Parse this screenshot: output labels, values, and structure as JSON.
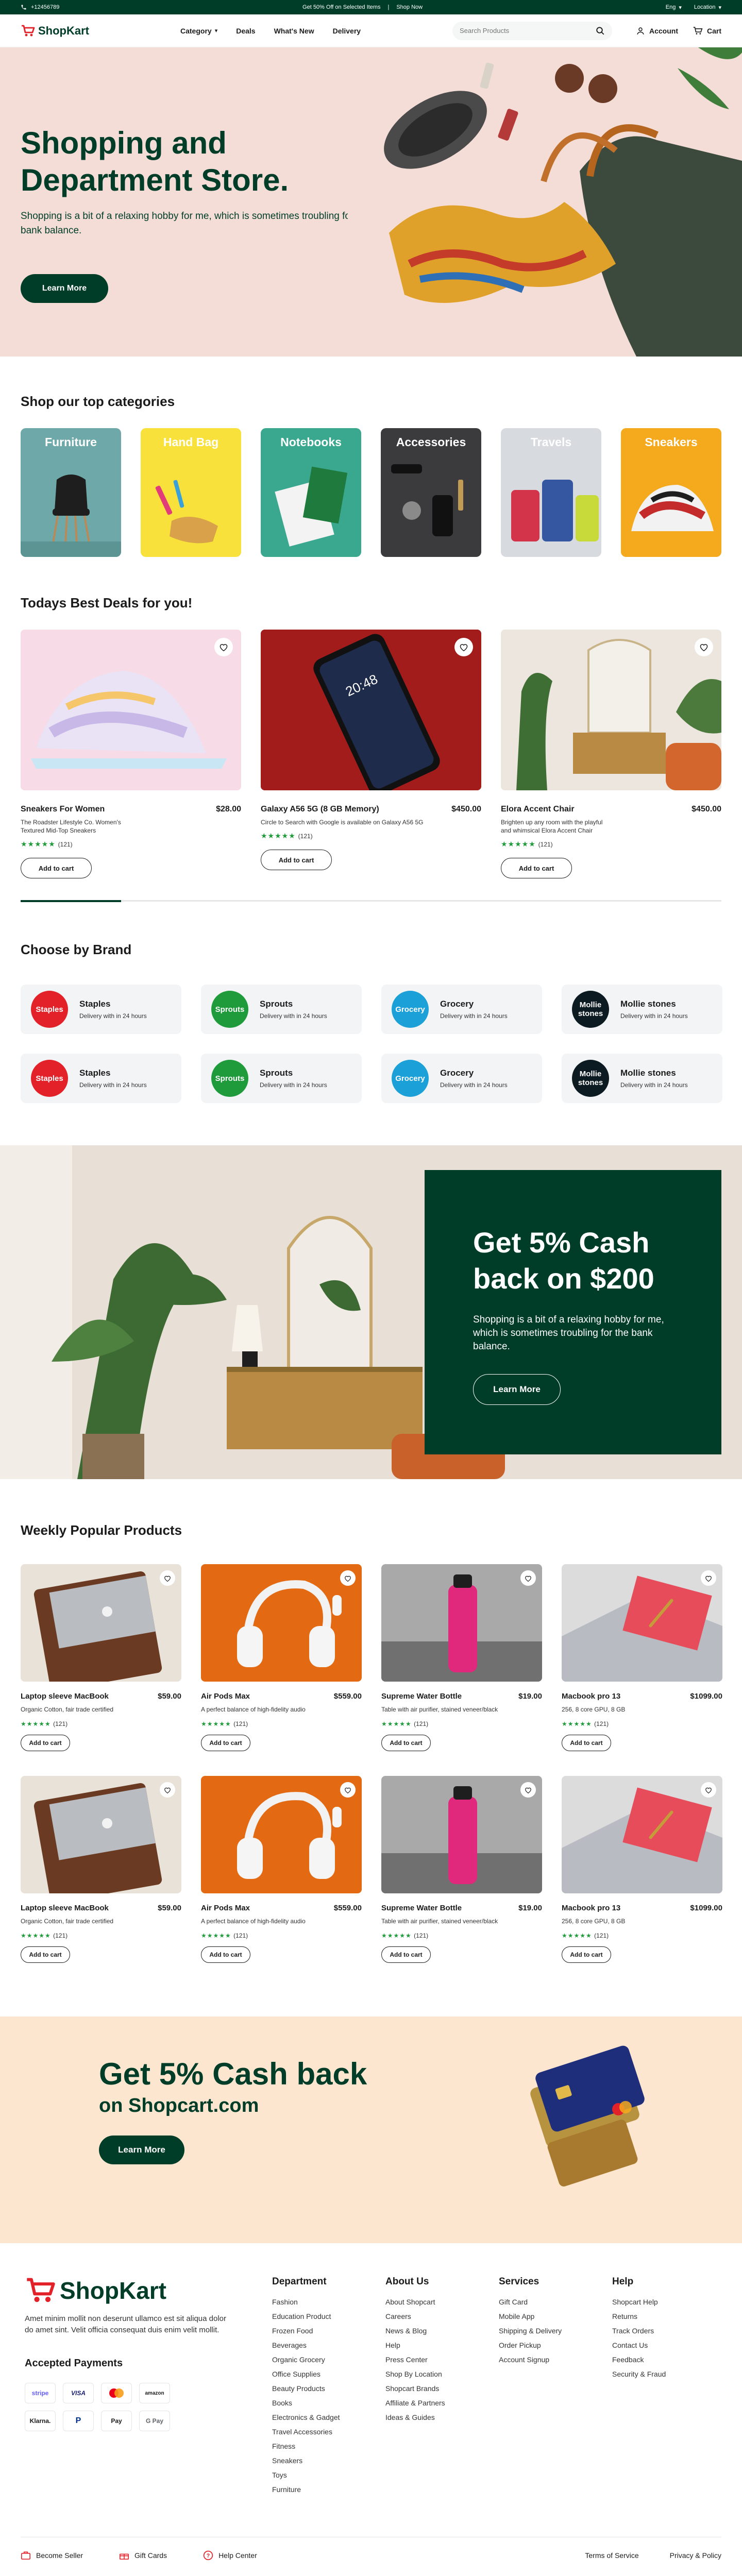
{
  "topbar": {
    "phone": "+12456789",
    "promo": "Get 50% Off on Selected Items",
    "shop_now": "Shop Now",
    "language": "Eng",
    "location": "Location"
  },
  "header": {
    "brand": "ShopKart",
    "nav": [
      "Category",
      "Deals",
      "What's New",
      "Delivery"
    ],
    "search_placeholder": "Search Products",
    "account": "Account",
    "cart": "Cart"
  },
  "hero": {
    "title_line1": "Shopping and",
    "title_line2": "Department Store.",
    "subtitle": "Shopping is a bit of a relaxing hobby for me, which is sometimes troubling for the bank balance.",
    "cta": "Learn More"
  },
  "categories": {
    "title": "Shop our top categories",
    "items": [
      {
        "label": "Furniture",
        "color": "#6fa8a8"
      },
      {
        "label": "Hand Bag",
        "color": "#f7e13a"
      },
      {
        "label": "Notebooks",
        "color": "#3aa78f"
      },
      {
        "label": "Accessories",
        "color": "#3b3b3e"
      },
      {
        "label": "Travels",
        "color": "#d7dbe0"
      },
      {
        "label": "Sneakers",
        "color": "#f5a91d"
      }
    ]
  },
  "deals": {
    "title": "Todays Best Deals for you!",
    "items": [
      {
        "name": "Sneakers For Women",
        "price": "$28.00",
        "desc": "The Roadster Lifestyle Co. Women's Textured Mid-Top Sneakers",
        "rating": "★★★★★",
        "count": "(121)",
        "cta": "Add to cart"
      },
      {
        "name": "Galaxy A56 5G (8 GB Memory)",
        "price": "$450.00",
        "desc": "Circle to Search with Google is available on Galaxy A56 5G",
        "rating": "★★★★★",
        "count": "(121)",
        "cta": "Add to cart"
      },
      {
        "name": "Elora Accent Chair",
        "price": "$450.00",
        "desc": "Brighten up any room with the playful and whimsical Elora Accent Chair",
        "rating": "★★★★★",
        "count": "(121)",
        "cta": "Add to cart"
      }
    ]
  },
  "brands": {
    "title": "Choose by Brand",
    "items": [
      {
        "name": "Staples",
        "logo": "Staples",
        "delivery": "Delivery with in 24 hours",
        "color": "#e32128"
      },
      {
        "name": "Sprouts",
        "logo": "Sprouts",
        "delivery": "Delivery with in 24 hours",
        "color": "#1f9b3b"
      },
      {
        "name": "Grocery",
        "logo": "Grocery",
        "delivery": "Delivery with in 24 hours",
        "color": "#1ba0d8"
      },
      {
        "name": "Mollie stones",
        "logo": "Mollie stones",
        "delivery": "Delivery with in 24 hours",
        "color": "#0c1a22"
      },
      {
        "name": "Staples",
        "logo": "Staples",
        "delivery": "Delivery with in 24 hours",
        "color": "#e32128"
      },
      {
        "name": "Sprouts",
        "logo": "Sprouts",
        "delivery": "Delivery with in 24 hours",
        "color": "#1f9b3b"
      },
      {
        "name": "Grocery",
        "logo": "Grocery",
        "delivery": "Delivery with in 24 hours",
        "color": "#1ba0d8"
      },
      {
        "name": "Mollie stones",
        "logo": "Mollie stones",
        "delivery": "Delivery with in 24 hours",
        "color": "#0c1a22"
      }
    ]
  },
  "promo": {
    "title": "Get 5% Cash back on $200",
    "subtitle": "Shopping is a bit of a relaxing hobby for me, which is sometimes troubling for the bank balance.",
    "cta": "Learn More"
  },
  "weekly": {
    "title": "Weekly Popular Products",
    "items": [
      {
        "name": "Laptop sleeve MacBook",
        "price": "$59.00",
        "desc": "Organic Cotton, fair trade certified",
        "rating": "★★★★★",
        "count": "(121)",
        "cta": "Add to cart",
        "kind": "sleeve"
      },
      {
        "name": "Air Pods Max",
        "price": "$559.00",
        "desc": "A perfect balance of high-fidelity audio",
        "rating": "★★★★★",
        "count": "(121)",
        "cta": "Add to cart",
        "kind": "headphones"
      },
      {
        "name": "Supreme Water Bottle",
        "price": "$19.00",
        "desc": "Table with air purifier, stained veneer/black",
        "rating": "★★★★★",
        "count": "(121)",
        "cta": "Add to cart",
        "kind": "bottle"
      },
      {
        "name": "Macbook pro 13",
        "price": "$1099.00",
        "desc": "256, 8 core GPU, 8 GB",
        "rating": "★★★★★",
        "count": "(121)",
        "cta": "Add to cart",
        "kind": "laptop"
      },
      {
        "name": "Laptop sleeve MacBook",
        "price": "$59.00",
        "desc": "Organic Cotton, fair trade certified",
        "rating": "★★★★★",
        "count": "(121)",
        "cta": "Add to cart",
        "kind": "sleeve"
      },
      {
        "name": "Air Pods Max",
        "price": "$559.00",
        "desc": "A perfect balance of high-fidelity audio",
        "rating": "★★★★★",
        "count": "(121)",
        "cta": "Add to cart",
        "kind": "headphones"
      },
      {
        "name": "Supreme Water Bottle",
        "price": "$19.00",
        "desc": "Table with air purifier, stained veneer/black",
        "rating": "★★★★★",
        "count": "(121)",
        "cta": "Add to cart",
        "kind": "bottle"
      },
      {
        "name": "Macbook pro 13",
        "price": "$1099.00",
        "desc": "256, 8 core GPU, 8 GB",
        "rating": "★★★★★",
        "count": "(121)",
        "cta": "Add to cart",
        "kind": "laptop"
      }
    ]
  },
  "cashback": {
    "title": "Get 5% Cash back",
    "subtitle": "on Shopcart.com",
    "cta": "Learn More"
  },
  "footer": {
    "brand": "ShopKart",
    "about": "Amet minim mollit non deserunt ullamco est sit aliqua dolor do amet sint. Velit officia consequat duis enim velit mollit.",
    "payments_title": "Accepted Payments",
    "payments": [
      "stripe",
      "VISA",
      "MC",
      "amazon",
      "Klarna.",
      "P",
      "Pay",
      "G Pay"
    ],
    "columns": [
      {
        "title": "Department",
        "links": [
          "Fashion",
          "Education Product",
          "Frozen Food",
          "Beverages",
          "Organic Grocery",
          "Office Supplies",
          "Beauty Products",
          "Books",
          "Electronics & Gadget",
          "Travel Accessories",
          "Fitness",
          "Sneakers",
          "Toys",
          "Furniture"
        ]
      },
      {
        "title": "About Us",
        "links": [
          "About Shopcart",
          "Careers",
          "News & Blog",
          "Help",
          "Press Center",
          "Shop By Location",
          "Shopcart Brands",
          "Affiliate & Partners",
          "Ideas & Guides"
        ]
      },
      {
        "title": "Services",
        "links": [
          "Gift Card",
          "Mobile App",
          "Shipping & Delivery",
          "Order Pickup",
          "Account Signup"
        ]
      },
      {
        "title": "Help",
        "links": [
          "Shopcart Help",
          "Returns",
          "Track Orders",
          "Contact Us",
          "Feedback",
          "Security & Fraud"
        ]
      }
    ],
    "bottom": {
      "become_seller": "Become Seller",
      "gift_cards": "Gift Cards",
      "help_center": "Help Center",
      "terms": "Terms of Service",
      "privacy": "Privacy & Policy"
    }
  },
  "colors": {
    "brand_green": "#003d29",
    "accent_red": "#e32128",
    "hero_bg": "#f4ddd6",
    "cashback_bg": "#fde6d0"
  }
}
